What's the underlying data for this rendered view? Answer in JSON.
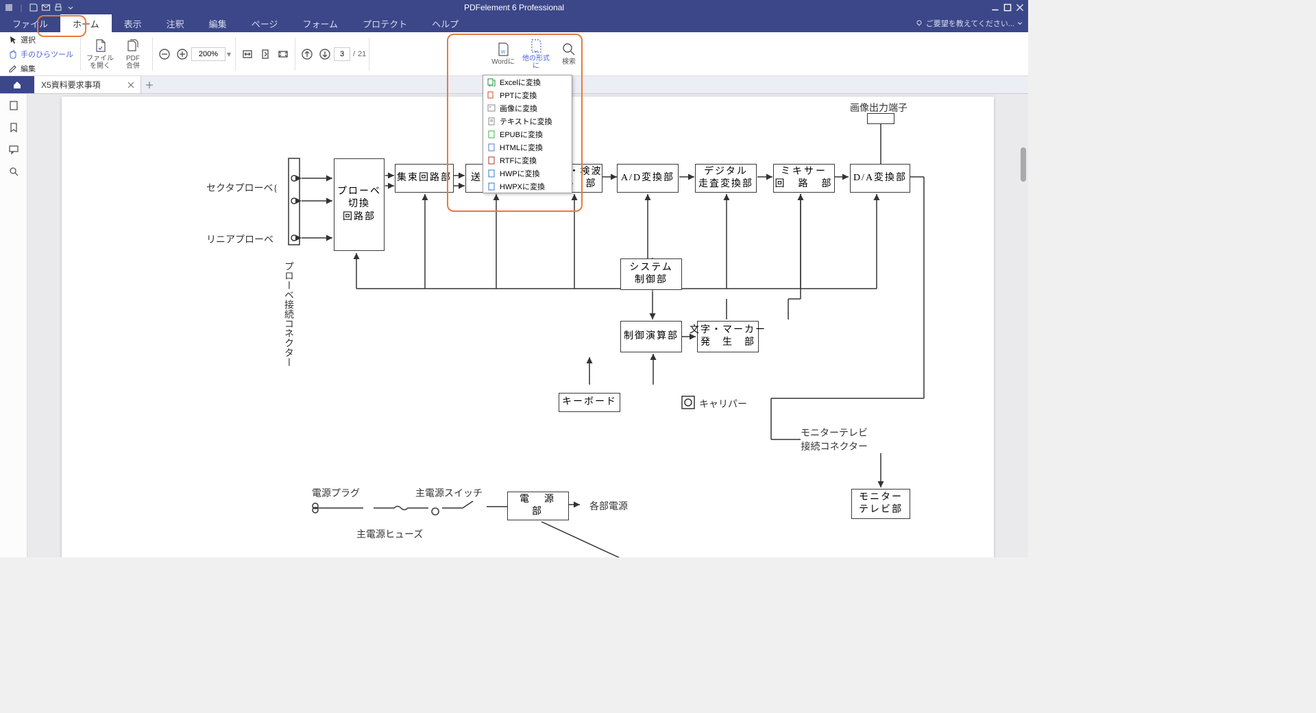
{
  "app": {
    "title": "PDFelement 6 Professional"
  },
  "menus": {
    "file": "ファイル",
    "home": "ホーム",
    "view": "表示",
    "comment": "注釈",
    "edit": "編集",
    "page": "ページ",
    "form": "フォーム",
    "protect": "プロテクト",
    "help": "ヘルプ"
  },
  "feedback": "ご要望を教えてください...",
  "tools": {
    "select": "選択",
    "hand": "手のひらツール",
    "edit": "編集"
  },
  "ribbon": {
    "openFile": "ファイル\nを開く",
    "combine": "PDF\n合併",
    "zoom": "200%",
    "pageCurrent": "3",
    "pageSep": "/",
    "pageTotal": "21",
    "toWord": "Wordに",
    "toOther": "他の形式に",
    "search": "検索"
  },
  "tab": {
    "name": "X5資料要求事項"
  },
  "dropdown": [
    {
      "key": "excel",
      "label": "Excelに変換",
      "color": "#1e8c3a"
    },
    {
      "key": "ppt",
      "label": "PPTに変換",
      "color": "#d24726"
    },
    {
      "key": "image",
      "label": "画像に変換",
      "color": "#888"
    },
    {
      "key": "text",
      "label": "テキストに変換",
      "color": "#888"
    },
    {
      "key": "epub",
      "label": "EPUBに変換",
      "color": "#3bb54a"
    },
    {
      "key": "html",
      "label": "HTMLに変換",
      "color": "#4d7dd6"
    },
    {
      "key": "rtf",
      "label": "RTFに変換",
      "color": "#b03030"
    },
    {
      "key": "hwp",
      "label": "HWPに変換",
      "color": "#2e7dd1"
    },
    {
      "key": "hwpx",
      "label": "HWPXに変換",
      "color": "#2e7dd1"
    }
  ],
  "diagram": {
    "sectorProbe": "セクタプローベ{",
    "linearProbe": "リニアプローベ",
    "probeConnector": "プローベ接続コネクター",
    "probeSwitch": "プローベ\n切換\n回路部",
    "focusCircuit": "集束回路部",
    "transmit": "送",
    "detector": "晶・検波\n路　部",
    "adConverter": "A/D変換部",
    "digitalScan": "デジタル\n走査変換部",
    "mixer": "ミキサー\n回　路　部",
    "daConverter": "D/A変換部",
    "imageOutTerminal": "画像出力端子",
    "systemControl": "システム\n制御部",
    "controlArithmetic": "制御演算部",
    "charMarker": "文字・マーカー\n発　生　部",
    "keyboard": "キーボード",
    "caliper": "キャリパー",
    "monitorConnector": "モニターテレビ\n接続コネクター",
    "monitorTV": "モニター\nテレビ部",
    "powerPlug": "電源プラグ",
    "mainSwitch": "主電源スイッチ",
    "mainFuse": "主電源ヒューズ",
    "powerUnit": "電　源　部",
    "toEachPower": "各部電源"
  }
}
